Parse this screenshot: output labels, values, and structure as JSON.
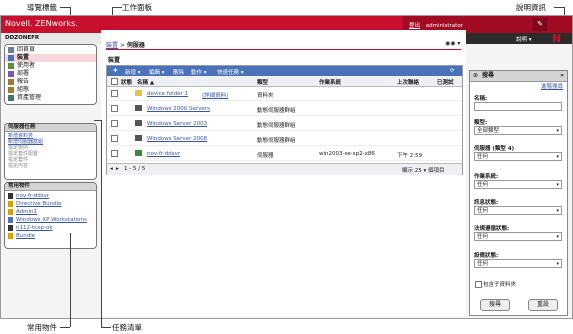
{
  "callouts": {
    "nav_tabs": "導覽標籤",
    "work_panel": "工作面板",
    "help_info": "說明資訊",
    "favorites": "常用物件",
    "task_list": "任務清單"
  },
  "header": {
    "brand": "Novell. ZENworks.",
    "logout": "登出",
    "user": "administrator",
    "help_tab": "說明 ▾",
    "zone": "DDZONEFR",
    "n_logo": "N"
  },
  "nav": {
    "items": [
      {
        "label": "回首頁",
        "icon": "home-icon",
        "color": "#6f7f8f"
      },
      {
        "label": "裝置",
        "icon": "devices-icon",
        "color": "#4a72b8"
      },
      {
        "label": "使用者",
        "icon": "users-icon",
        "color": "#5a8f3a"
      },
      {
        "label": "部署",
        "icon": "deploy-icon",
        "color": "#7a5aa5"
      },
      {
        "label": "報告",
        "icon": "report-icon",
        "color": "#9c7c36"
      },
      {
        "label": "組態",
        "icon": "config-icon",
        "color": "#a57a2a"
      },
      {
        "label": "資產管理",
        "icon": "asset-icon",
        "color": "#3a7a6a"
      }
    ]
  },
  "tasks": {
    "title": "伺服器任務",
    "items": [
      "新增資料夾",
      "新增伺服器群組",
      "指定規則",
      "指定套件配置",
      "指定套件",
      "指定內容"
    ]
  },
  "favorites": {
    "title": "常用物件",
    "items": [
      "nov-fr-ddsvr",
      "Directive Bundle",
      "Admin1",
      "Windows XP Workstations",
      "n112-tcxp-ok",
      "Bundle"
    ]
  },
  "content": {
    "breadcrumb_home": "裝置",
    "breadcrumb_sep": ">",
    "breadcrumb_current": "伺服器",
    "title": "裝置",
    "toolbar": [
      "新增 ▾",
      "編輯 ▾",
      "刪除",
      "動作 ▾",
      "快速任務 ▾"
    ],
    "columns": [
      "狀態",
      "名稱 ▲",
      "類型",
      "作業系統",
      "上次聯絡",
      "已測試"
    ],
    "rows": [
      {
        "name": "device folder 1",
        "extra": "(詳細資料)",
        "type": "資料夾",
        "os": "",
        "last": "",
        "icon": "folder-icon"
      },
      {
        "name": "Windows 2000 Servers",
        "extra": "",
        "type": "動態伺服器群組",
        "os": "",
        "last": "",
        "icon": "group-icon"
      },
      {
        "name": "Windows Server 2003",
        "extra": "",
        "type": "動態伺服器群組",
        "os": "",
        "last": "",
        "icon": "group-icon"
      },
      {
        "name": "Windows Server 2008",
        "extra": "",
        "type": "動態伺服器群組",
        "os": "",
        "last": "",
        "icon": "group-icon"
      },
      {
        "name": "nov-fr-ddsvr",
        "extra": "",
        "type": "伺服器",
        "os": "win2003-se-sp2-x86",
        "last": "下午 2:59",
        "icon": "server-icon"
      }
    ],
    "pager_range": "1 - 5 / 5",
    "pager_show": "顯示 25 ▾ 個項目"
  },
  "search": {
    "title": "搜尋",
    "advanced": "進階搜尋",
    "name_label": "名稱:",
    "type_label": "類型:",
    "type_value": "全部類型",
    "server_label": "伺服器 (類型 4)",
    "server_value": "任何",
    "os_label": "作業系統:",
    "os_value": "任何",
    "msg_label": "訊息狀態:",
    "msg_value": "任何",
    "compliance_label": "法規遵循狀態:",
    "compliance_value": "任何",
    "device_label": "設備狀態:",
    "device_value": "任何",
    "include_sub": "包含子資料夾",
    "search_btn": "搜尋",
    "reset_btn": "重設"
  }
}
